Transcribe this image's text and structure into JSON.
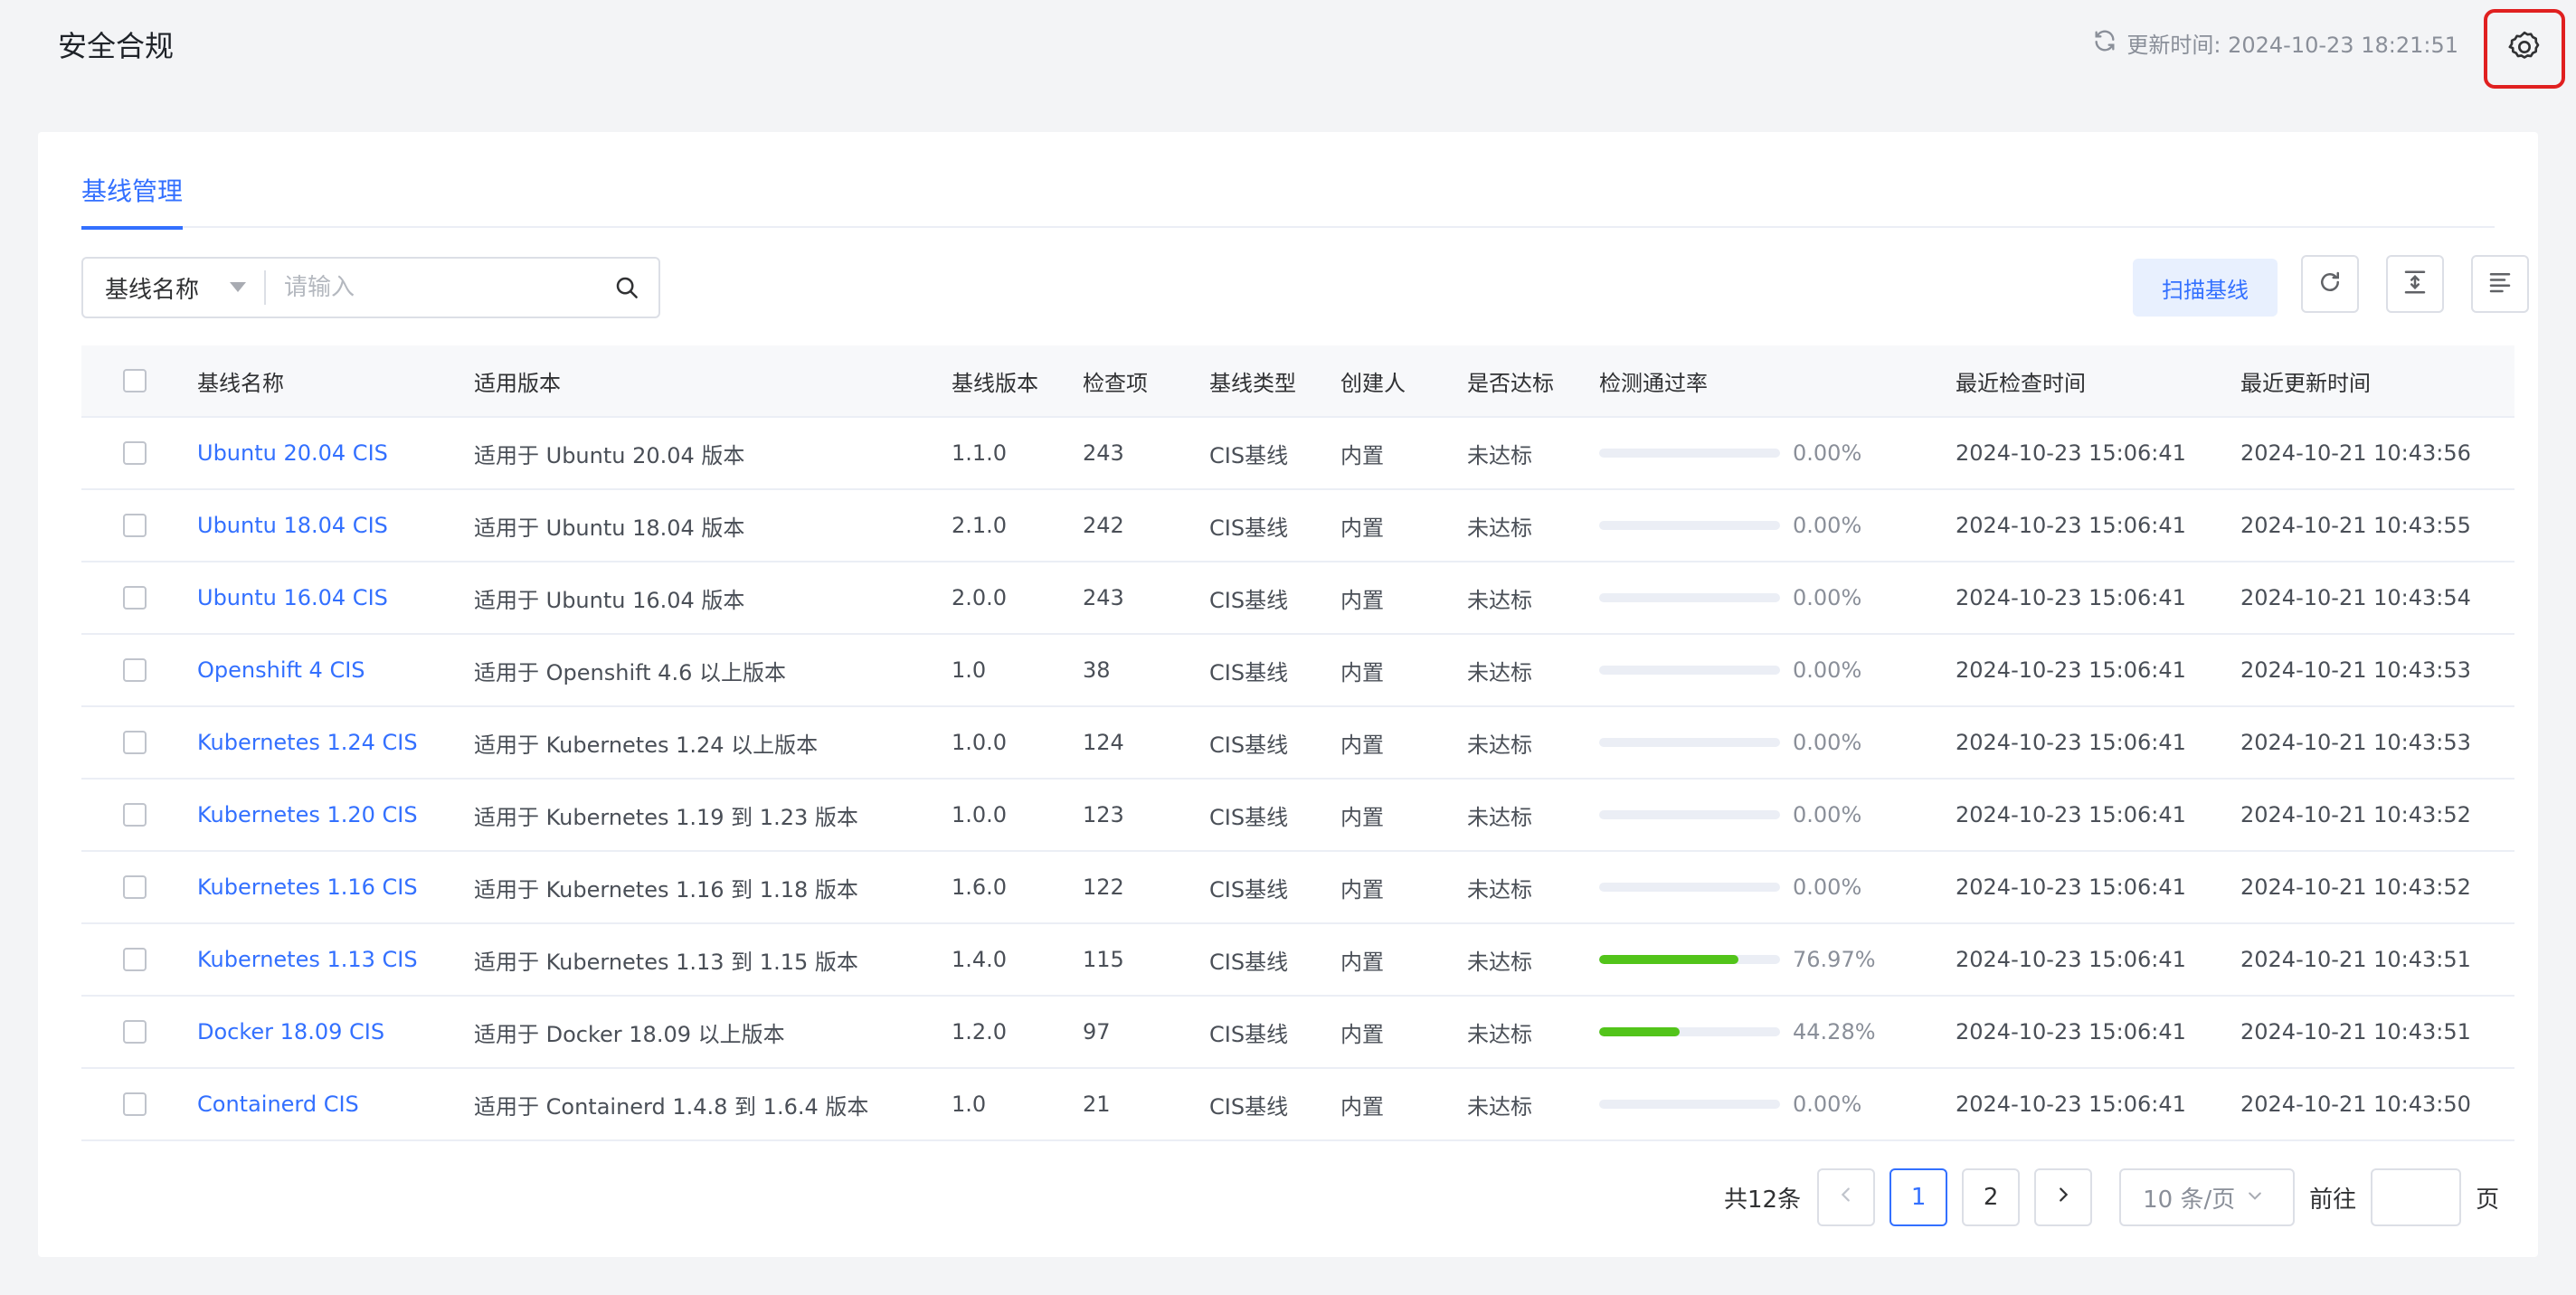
{
  "header": {
    "title": "安全合规",
    "update_label": "更新时间: 2024-10-23 18:21:51"
  },
  "tabs": [
    {
      "label": "基线管理",
      "active": true
    }
  ],
  "search": {
    "field_select": "基线名称",
    "placeholder": "请输入"
  },
  "toolbar": {
    "scan_label": "扫描基线",
    "icons": [
      "refresh-icon",
      "expand-icon",
      "columns-icon"
    ]
  },
  "table": {
    "columns": [
      "基线名称",
      "适用版本",
      "基线版本",
      "检查项",
      "基线类型",
      "创建人",
      "是否达标",
      "检测通过率",
      "最近检查时间",
      "最近更新时间"
    ],
    "rows": [
      {
        "name": "Ubuntu 20.04 CIS",
        "applicable": "适用于 Ubuntu 20.04 版本",
        "version": "1.1.0",
        "items": "243",
        "type": "CIS基线",
        "creator": "内置",
        "compliant": "未达标",
        "rate": "0.00%",
        "rate_value": 0,
        "checked": "2024-10-23 15:06:41",
        "updated": "2024-10-21 10:43:56"
      },
      {
        "name": "Ubuntu 18.04 CIS",
        "applicable": "适用于 Ubuntu 18.04 版本",
        "version": "2.1.0",
        "items": "242",
        "type": "CIS基线",
        "creator": "内置",
        "compliant": "未达标",
        "rate": "0.00%",
        "rate_value": 0,
        "checked": "2024-10-23 15:06:41",
        "updated": "2024-10-21 10:43:55"
      },
      {
        "name": "Ubuntu 16.04 CIS",
        "applicable": "适用于 Ubuntu 16.04 版本",
        "version": "2.0.0",
        "items": "243",
        "type": "CIS基线",
        "creator": "内置",
        "compliant": "未达标",
        "rate": "0.00%",
        "rate_value": 0,
        "checked": "2024-10-23 15:06:41",
        "updated": "2024-10-21 10:43:54"
      },
      {
        "name": "Openshift 4 CIS",
        "applicable": "适用于 Openshift 4.6 以上版本",
        "version": "1.0",
        "items": "38",
        "type": "CIS基线",
        "creator": "内置",
        "compliant": "未达标",
        "rate": "0.00%",
        "rate_value": 0,
        "checked": "2024-10-23 15:06:41",
        "updated": "2024-10-21 10:43:53"
      },
      {
        "name": "Kubernetes 1.24 CIS",
        "applicable": "适用于 Kubernetes 1.24 以上版本",
        "version": "1.0.0",
        "items": "124",
        "type": "CIS基线",
        "creator": "内置",
        "compliant": "未达标",
        "rate": "0.00%",
        "rate_value": 0,
        "checked": "2024-10-23 15:06:41",
        "updated": "2024-10-21 10:43:53"
      },
      {
        "name": "Kubernetes 1.20 CIS",
        "applicable": "适用于 Kubernetes 1.19 到 1.23 版本",
        "version": "1.0.0",
        "items": "123",
        "type": "CIS基线",
        "creator": "内置",
        "compliant": "未达标",
        "rate": "0.00%",
        "rate_value": 0,
        "checked": "2024-10-23 15:06:41",
        "updated": "2024-10-21 10:43:52"
      },
      {
        "name": "Kubernetes 1.16 CIS",
        "applicable": "适用于 Kubernetes 1.16 到 1.18 版本",
        "version": "1.6.0",
        "items": "122",
        "type": "CIS基线",
        "creator": "内置",
        "compliant": "未达标",
        "rate": "0.00%",
        "rate_value": 0,
        "checked": "2024-10-23 15:06:41",
        "updated": "2024-10-21 10:43:52"
      },
      {
        "name": "Kubernetes 1.13 CIS",
        "applicable": "适用于 Kubernetes 1.13 到 1.15 版本",
        "version": "1.4.0",
        "items": "115",
        "type": "CIS基线",
        "creator": "内置",
        "compliant": "未达标",
        "rate": "76.97%",
        "rate_value": 76.97,
        "checked": "2024-10-23 15:06:41",
        "updated": "2024-10-21 10:43:51"
      },
      {
        "name": "Docker 18.09 CIS",
        "applicable": "适用于 Docker 18.09 以上版本",
        "version": "1.2.0",
        "items": "97",
        "type": "CIS基线",
        "creator": "内置",
        "compliant": "未达标",
        "rate": "44.28%",
        "rate_value": 44.28,
        "checked": "2024-10-23 15:06:41",
        "updated": "2024-10-21 10:43:51"
      },
      {
        "name": "Containerd CIS",
        "applicable": "适用于 Containerd 1.4.8 到 1.6.4 版本",
        "version": "1.0",
        "items": "21",
        "type": "CIS基线",
        "creator": "内置",
        "compliant": "未达标",
        "rate": "0.00%",
        "rate_value": 0,
        "checked": "2024-10-23 15:06:41",
        "updated": "2024-10-21 10:43:50"
      }
    ]
  },
  "pagination": {
    "total": "共12条",
    "pages": [
      "1",
      "2"
    ],
    "current": "1",
    "page_size": "10 条/页",
    "goto_label": "前往",
    "page_unit": "页"
  },
  "colors": {
    "accent": "#3370ff",
    "progress": "#52c41a",
    "highlight_border": "#e02020"
  }
}
